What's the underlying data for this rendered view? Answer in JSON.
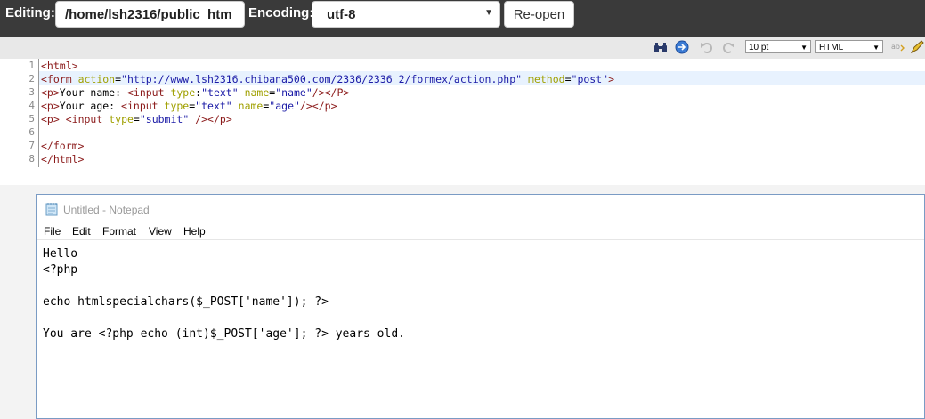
{
  "topbar": {
    "editing_label": "Editing:",
    "path_value": "/home/lsh2316/public_htm",
    "encoding_label": "Encoding:",
    "encoding_value": "utf-8",
    "reopen_label": "Re-open"
  },
  "toolbar": {
    "font_size": "10 pt",
    "syntax": "HTML"
  },
  "editor": {
    "line_numbers": [
      "1",
      "2",
      "3",
      "4",
      "5",
      "6",
      "7",
      "8"
    ],
    "lines": [
      "<html>",
      "<form action=\"http://www.lsh2316.chibana500.com/2336/2336_2/formex/action.php\" method=\"post\">",
      "<p>Your name: <input type:\"text\" name=\"name\"/></P>",
      "<p>Your age: <input type=\"text\" name=\"age\"/></p>",
      "<p> <input type=\"submit\" /></p>",
      "",
      "</form>",
      "</html>"
    ]
  },
  "notepad": {
    "title": "Untitled - Notepad",
    "menu": [
      "File",
      "Edit",
      "Format",
      "View",
      "Help"
    ],
    "lines": [
      "Hello",
      "<?php",
      "",
      "echo htmlspecialchars($_POST['name']); ?>",
      "",
      "You are <?php echo (int)$_POST['age']; ?> years old."
    ]
  },
  "colors": {
    "topbar_bg": "#3a3a3a",
    "active_line": "#e8f2fe",
    "tag": "#8b1a1a",
    "attr": "#a0a000",
    "value": "#1a1aa6"
  }
}
